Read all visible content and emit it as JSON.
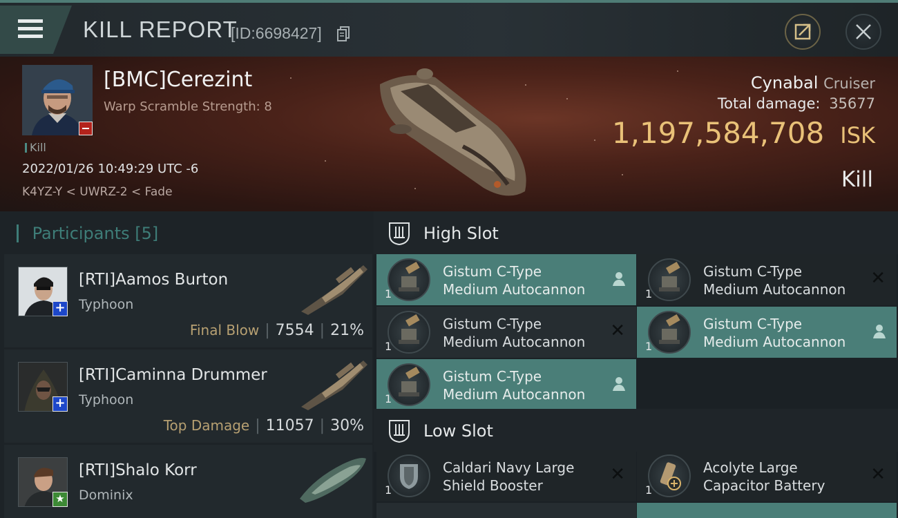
{
  "header": {
    "title": "KILL REPORT",
    "report_id": "[ID:6698427]"
  },
  "victim": {
    "name": "[BMC]Cerezint",
    "subtitle": "Warp Scramble Strength: 8",
    "tag": "Kill",
    "datetime": "2022/01/26 10:49:29 UTC -6",
    "location": "K4YZ-Y < UWRZ-2 < Fade",
    "ship_name": "Cynabal",
    "ship_class": "Cruiser",
    "total_damage_label": "Total damage:",
    "total_damage": "35677",
    "isk_value": "1,197,584,708",
    "isk_unit": "ISK",
    "result": "Kill"
  },
  "participants": {
    "label": "Participants",
    "count": "[5]",
    "items": [
      {
        "name": "[RTI]Aamos Burton",
        "ship": "Typhoon",
        "tag": "Final Blow",
        "damage": "7554",
        "percent": "21%",
        "badge": "+"
      },
      {
        "name": "[RTI]Caminna Drummer",
        "ship": "Typhoon",
        "tag": "Top Damage",
        "damage": "11057",
        "percent": "30%",
        "badge": "+"
      },
      {
        "name": "[RTI]Shalo Korr",
        "ship": "Dominix",
        "tag": "",
        "damage": "",
        "percent": "",
        "badge": "★"
      }
    ]
  },
  "fittings": {
    "high_slot_title": "High Slot",
    "low_slot_title": "Low Slot",
    "high": [
      {
        "name1": "Gistum C-Type",
        "name2": "Medium Autocannon",
        "qty": "1",
        "state": "pilot"
      },
      {
        "name1": "Gistum C-Type",
        "name2": "Medium Autocannon",
        "qty": "1",
        "state": "destroyed"
      },
      {
        "name1": "Gistum C-Type",
        "name2": "Medium Autocannon",
        "qty": "1",
        "state": "destroyed"
      },
      {
        "name1": "Gistum C-Type",
        "name2": "Medium Autocannon",
        "qty": "1",
        "state": "pilot"
      },
      {
        "name1": "Gistum C-Type",
        "name2": "Medium Autocannon",
        "qty": "1",
        "state": "pilot"
      }
    ],
    "low": [
      {
        "name1": "Caldari Navy Large",
        "name2": "Shield Booster",
        "qty": "1",
        "state": "destroyed"
      },
      {
        "name1": "Acolyte Large",
        "name2": "Capacitor Battery",
        "qty": "1",
        "state": "destroyed"
      }
    ]
  },
  "colors": {
    "accent_teal": "#4a7e78",
    "isk_gold": "#e9c178",
    "header_teal": "#3e7d78"
  }
}
